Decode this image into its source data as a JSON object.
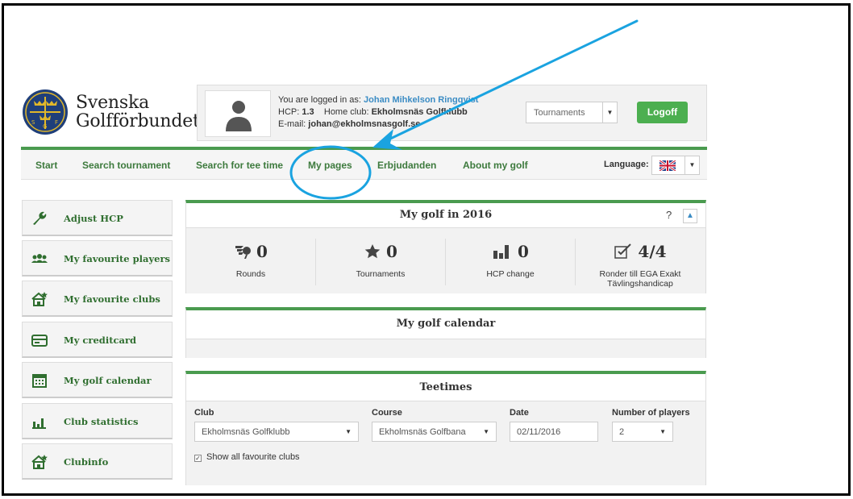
{
  "brand": {
    "name_line1": "Svenska",
    "name_line2": "Golfförbundet",
    "emblem_letters": [
      "S",
      "G",
      "F"
    ]
  },
  "user": {
    "logged_in_label": "You are logged in as:",
    "name": "Johan Mihkelson Ringqvist",
    "hcp_label": "HCP:",
    "hcp_value": "1.3",
    "home_club_label": "Home club:",
    "home_club": "Ekholmsnäs Golfklubb",
    "email_label": "E-mail:",
    "email": "johan@ekholmsnasgolf.se"
  },
  "header": {
    "tournaments_select": "Tournaments",
    "logoff_label": "Logoff"
  },
  "nav": {
    "items": [
      "Start",
      "Search tournament",
      "Search for tee time",
      "My pages",
      "Erbjudanden",
      "About my golf"
    ],
    "language_label": "Language:",
    "language_flag": "uk-flag-icon"
  },
  "sidebar": {
    "items": [
      {
        "label": "Adjust HCP",
        "icon": "wrench-icon"
      },
      {
        "label": "My favourite players",
        "icon": "users-icon"
      },
      {
        "label": "My favourite clubs",
        "icon": "house-star-icon"
      },
      {
        "label": "My creditcard",
        "icon": "credit-card-icon"
      },
      {
        "label": "My golf calendar",
        "icon": "calendar-icon"
      },
      {
        "label": "Club statistics",
        "icon": "bar-chart-icon"
      },
      {
        "label": "Clubinfo",
        "icon": "house-star-icon"
      }
    ]
  },
  "mygolf": {
    "title": "My golf in 2016",
    "help": "?",
    "stats": [
      {
        "value": "0",
        "label": "Rounds",
        "icon": "golf-swing-icon"
      },
      {
        "value": "0",
        "label": "Tournaments",
        "icon": "star-icon"
      },
      {
        "value": "0",
        "label": "HCP change",
        "icon": "bar-chart-icon"
      },
      {
        "value": "4/4",
        "label_line1": "Ronder till EGA Exakt",
        "label_line2": "Tävlingshandicap",
        "icon": "checkbox-icon"
      }
    ]
  },
  "calendar": {
    "title": "My golf calendar"
  },
  "teetimes": {
    "title": "Teetimes",
    "club_label": "Club",
    "club_value": "Ekholmsnäs Golfklubb",
    "course_label": "Course",
    "course_value": "Ekholmsnäs Golfbana",
    "date_label": "Date",
    "date_value": "02/11/2016",
    "players_label": "Number of players",
    "players_value": "2",
    "show_favourites": "Show all favourite clubs"
  },
  "colors": {
    "accent_green": "#4a9b4f",
    "link_blue": "#3b8cc4",
    "annotation_blue": "#1aa3e0",
    "logoff_green": "#4caf50"
  }
}
